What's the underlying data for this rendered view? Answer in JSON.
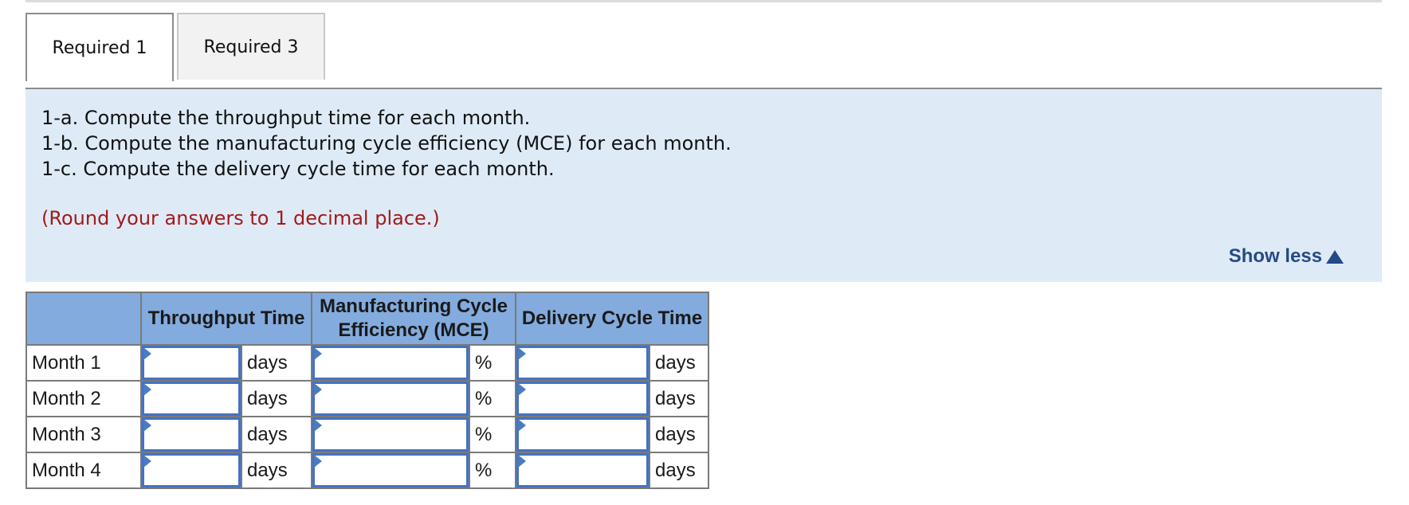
{
  "tabs": [
    {
      "label": "Required 1",
      "active": true
    },
    {
      "label": "Required 3",
      "active": false
    }
  ],
  "instructions": {
    "lines": [
      "1-a. Compute the throughput time for each month.",
      "1-b. Compute the manufacturing cycle efficiency (MCE) for each month.",
      "1-c. Compute the delivery cycle time for each month."
    ],
    "round_note": "(Round your answers to 1 decimal place.)",
    "toggle_label": "Show less"
  },
  "table": {
    "headers": {
      "blank": "",
      "throughput": "Throughput Time",
      "mce_line1": "Manufacturing Cycle",
      "mce_line2": "Efficiency (MCE)",
      "delivery": "Delivery Cycle Time"
    },
    "rows": [
      {
        "label": "Month 1",
        "throughput_value": "",
        "throughput_unit": "days",
        "mce_value": "",
        "mce_unit": "%",
        "delivery_value": "",
        "delivery_unit": "days"
      },
      {
        "label": "Month 2",
        "throughput_value": "",
        "throughput_unit": "days",
        "mce_value": "",
        "mce_unit": "%",
        "delivery_value": "",
        "delivery_unit": "days"
      },
      {
        "label": "Month 3",
        "throughput_value": "",
        "throughput_unit": "days",
        "mce_value": "",
        "mce_unit": "%",
        "delivery_value": "",
        "delivery_unit": "days"
      },
      {
        "label": "Month 4",
        "throughput_value": "",
        "throughput_unit": "days",
        "mce_value": "",
        "mce_unit": "%",
        "delivery_value": "",
        "delivery_unit": "days"
      }
    ]
  },
  "colors": {
    "header_bg": "#83abde",
    "instructions_bg": "#deebf7",
    "note_red": "#a31a1a",
    "link_blue": "#244a86",
    "input_border": "#4472c4"
  }
}
